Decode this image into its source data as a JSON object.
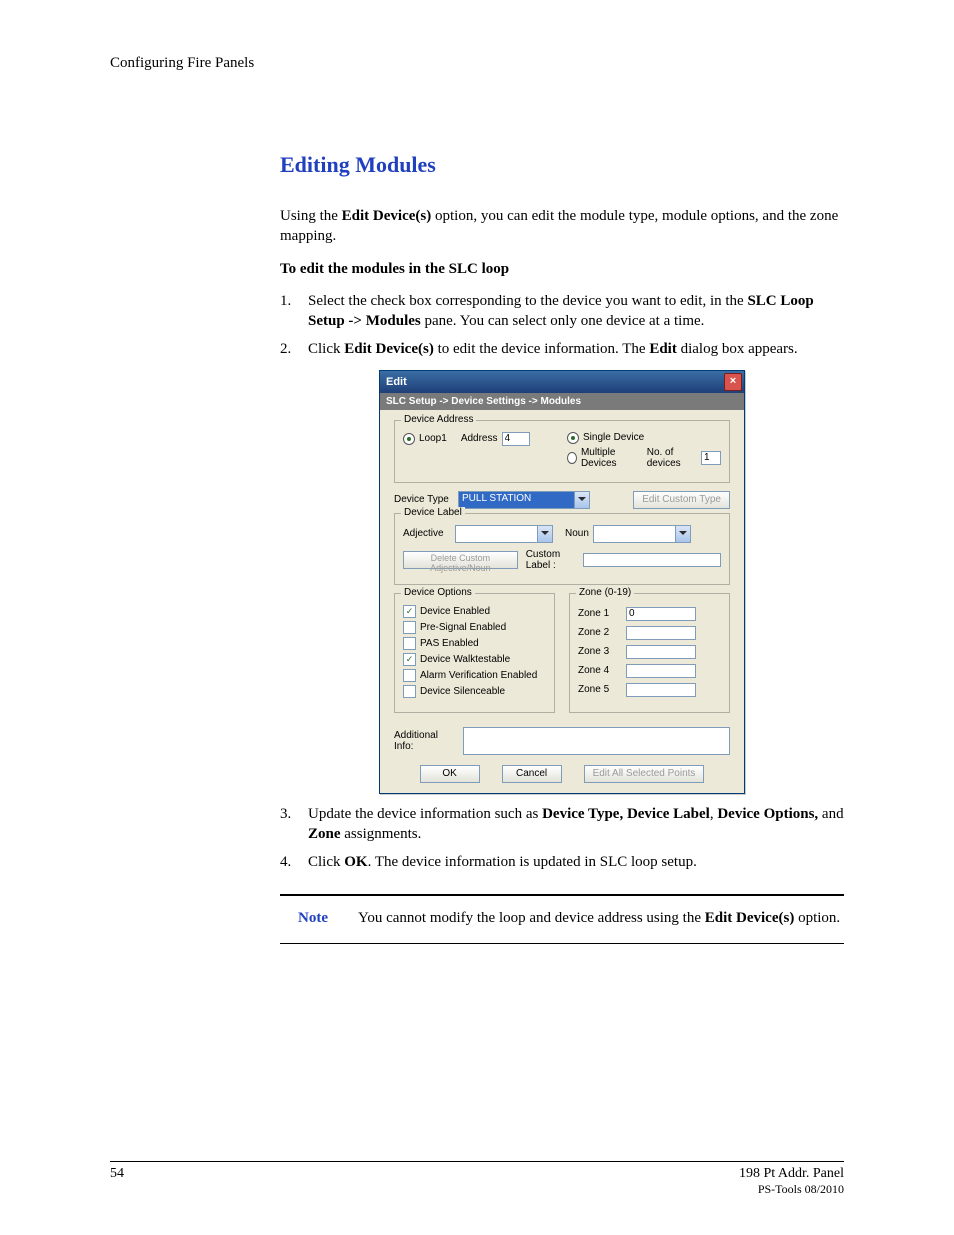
{
  "header": {
    "title": "Configuring Fire Panels"
  },
  "section": {
    "heading": "Editing Modules"
  },
  "intro": {
    "p1_a": "Using the ",
    "p1_b": "Edit Device(s)",
    "p1_c": " option, you can edit the module type, module options, and the zone mapping.",
    "p2": "To edit the modules in the SLC loop"
  },
  "steps": {
    "s1_a": "Select the check box corresponding to the device you want to edit, in the ",
    "s1_b": "SLC Loop Setup -> Modules",
    "s1_c": " pane. You can select only one device at a time.",
    "s2_a": "Click ",
    "s2_b": "Edit Device(s)",
    "s2_c": " to edit the device information. The ",
    "s2_d": "Edit",
    "s2_e": " dialog box appears.",
    "s3_a": "Update the device information such as ",
    "s3_b": "Device Type, Device Label",
    "s3_c": ", ",
    "s3_d": "Device Options,",
    "s3_e": " and ",
    "s3_f": "Zone",
    "s3_g": " assignments.",
    "s4_a": "Click ",
    "s4_b": "OK",
    "s4_c": ". The device information is updated in SLC loop setup.",
    "n1": "1.",
    "n2": "2.",
    "n3": "3.",
    "n4": "4."
  },
  "dialog": {
    "title": "Edit",
    "breadcrumb": "SLC Setup -> Device Settings -> Modules",
    "device_address": {
      "legend": "Device Address",
      "loop_radio": "Loop1",
      "address_label": "Address",
      "address_value": "4",
      "single": "Single Device",
      "multiple": "Multiple Devices",
      "no_label": "No. of devices",
      "no_value": "1"
    },
    "device_type": {
      "label": "Device Type",
      "value": "PULL STATION",
      "edit_custom": "Edit Custom Type"
    },
    "device_label": {
      "legend": "Device Label",
      "adjective": "Adjective",
      "noun": "Noun",
      "delete_btn": "Delete Custom Adjective/Noun",
      "custom_label": "Custom Label :"
    },
    "device_options": {
      "legend": "Device Options",
      "o1": "Device Enabled",
      "o2": "Pre-Signal Enabled",
      "o3": "PAS Enabled",
      "o4": "Device Walktestable",
      "o5": "Alarm Verification Enabled",
      "o6": "Device Silenceable"
    },
    "zone": {
      "legend": "Zone (0-19)",
      "z1": "Zone 1",
      "z1v": "0",
      "z2": "Zone 2",
      "z3": "Zone 3",
      "z4": "Zone 4",
      "z5": "Zone 5"
    },
    "additional": "Additional Info:",
    "buttons": {
      "ok": "OK",
      "cancel": "Cancel",
      "edit_all": "Edit All Selected Points"
    }
  },
  "note": {
    "label": "Note",
    "a": "You cannot modify the loop and device address using the ",
    "b": "Edit Device(s)",
    "c": " option."
  },
  "footer": {
    "page": "54",
    "right1": "198 Pt Addr. Panel",
    "right2": "PS-Tools   08/2010"
  }
}
